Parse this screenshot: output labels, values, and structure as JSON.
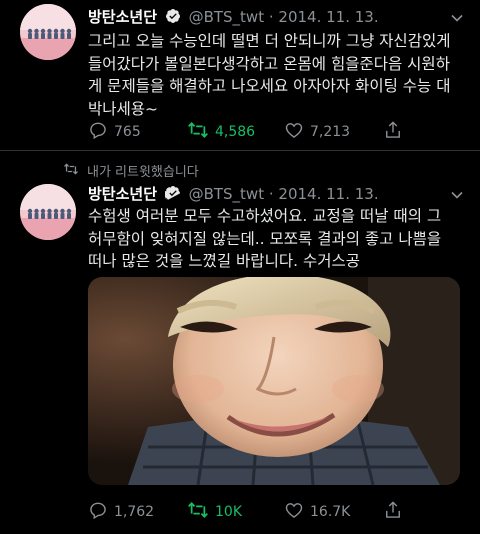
{
  "tweets": [
    {
      "name": "방탄소년단",
      "handle": "@BTS_twt",
      "date": "· 2014. 11. 13.",
      "lines": [
        "그리고 오늘 수능인데 떨면 더 안되니까 그냥 자신감있게",
        "들어갔다가 볼일본다생각하고 온몸에 힘을준다음 시원하",
        "게 문제들을 해결하고 나오세요 아자아자 화이팅 수능 대",
        "박나세용~"
      ],
      "replies": "765",
      "retweets": "4,586",
      "likes": "7,213"
    },
    {
      "retweet_note": "내가 리트윗했습니다",
      "name": "방탄소년단",
      "handle": "@BTS_twt",
      "date": "· 2014. 11. 13.",
      "lines": [
        "수험생 여러분 모두 수고하셨어요. 교정을 떠날 때의 그",
        "허무함이 잊혀지질 않는데.. 모쪼록 결과의 좋고 나쁨을",
        "떠나 많은 것을 느꼈길 바랍니다. 수거스공"
      ],
      "replies": "1,762",
      "retweets": "10K",
      "likes": "16.7K"
    }
  ],
  "colors": {
    "background": "#000000",
    "text": "#e7e9ea",
    "muted": "#8b9196",
    "retweet_active": "#17bf63",
    "verified": "#e7e9ea"
  },
  "icons": [
    "verified-icon",
    "chevron-down-icon",
    "reply-icon",
    "retweet-icon",
    "like-icon",
    "share-icon"
  ]
}
